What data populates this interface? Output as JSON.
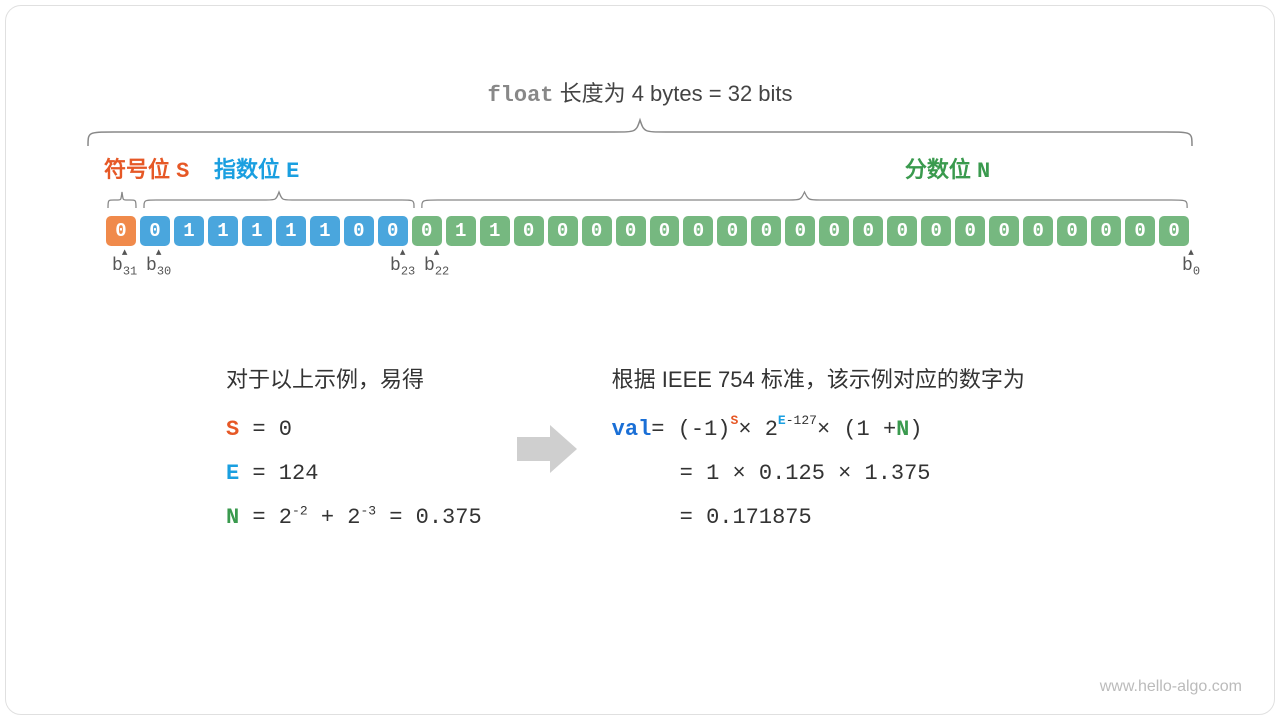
{
  "title": {
    "keyword": "float",
    "text": " 长度为 4 bytes = 32 bits"
  },
  "labels": {
    "sign": {
      "text": "符号位 ",
      "sym": "S"
    },
    "exp": {
      "text": "指数位 ",
      "sym": "E"
    },
    "frac": {
      "text": "分数位 ",
      "sym": "N"
    }
  },
  "bits": {
    "sign": [
      "0"
    ],
    "exp": [
      "0",
      "1",
      "1",
      "1",
      "1",
      "1",
      "0",
      "0"
    ],
    "frac": [
      "0",
      "1",
      "1",
      "0",
      "0",
      "0",
      "0",
      "0",
      "0",
      "0",
      "0",
      "0",
      "0",
      "0",
      "0",
      "0",
      "0",
      "0",
      "0",
      "0",
      "0",
      "0",
      "0"
    ]
  },
  "indices": {
    "b31": "b",
    "b31s": "31",
    "b30": "b",
    "b30s": "30",
    "b23": "b",
    "b23s": "23",
    "b22": "b",
    "b22s": "22",
    "b0": "b",
    "b0s": "0"
  },
  "eq_left": {
    "header": "对于以上示例，易得",
    "l1a": "S",
    "l1b": " = 0",
    "l2a": "E",
    "l2b": " = 124",
    "l3a": "N",
    "l3b": " = 2",
    "l3c": "-2",
    "l3d": " + 2",
    "l3e": "-3",
    "l3f": " = 0.375"
  },
  "eq_right": {
    "header": "根据 IEEE 754 标准，该示例对应的数字为",
    "r1a": "val",
    "r1b": " = (-1)",
    "r1c": "S",
    "r1d": " × 2",
    "r1e": "E",
    "r1f": "-127",
    "r1g": " × (1 + ",
    "r1h": "N",
    "r1i": ")",
    "r2": "= 1 × 0.125 × 1.375",
    "r3": "= 0.171875"
  },
  "watermark": "www.hello-algo.com"
}
